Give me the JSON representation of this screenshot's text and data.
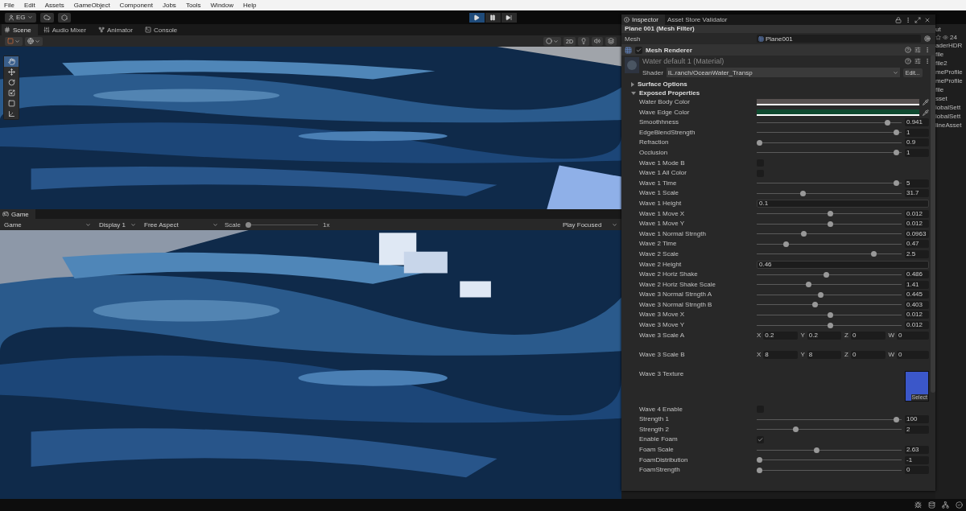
{
  "menu": [
    "File",
    "Edit",
    "Assets",
    "GameObject",
    "Component",
    "Jobs",
    "Tools",
    "Window",
    "Help"
  ],
  "toolbar": {
    "account": "EG"
  },
  "play_controls": [
    {
      "kind": "play",
      "selected": true
    },
    {
      "kind": "pause",
      "selected": false
    },
    {
      "kind": "step",
      "selected": false
    }
  ],
  "scene_tabs": [
    {
      "label": "Scene",
      "kind": "scene",
      "selected": true
    },
    {
      "label": "Audio Mixer",
      "kind": "mixer",
      "selected": false
    },
    {
      "label": "Animator",
      "kind": "animator",
      "selected": false
    },
    {
      "label": "Console",
      "kind": "console",
      "selected": false
    }
  ],
  "scene_toolbar": {
    "mode_2d": "2D"
  },
  "scene_tools": [
    {
      "kind": "hand",
      "selected": true
    },
    {
      "kind": "move",
      "selected": false
    },
    {
      "kind": "rotate",
      "selected": false
    },
    {
      "kind": "scale",
      "selected": false
    },
    {
      "kind": "rect",
      "selected": false
    },
    {
      "kind": "transform",
      "selected": false
    }
  ],
  "game_panel": {
    "tab": "Game",
    "view": "Game",
    "display": "Display 1",
    "aspect": "Free Aspect",
    "scale_label": "Scale",
    "scale": {
      "level": 0
    },
    "scale_value": "1x",
    "play_mode": "Play Focused"
  },
  "inspector": {
    "tabs": [
      {
        "label": "Inspector",
        "selected": true
      },
      {
        "label": "Asset Store Validator",
        "selected": false
      }
    ],
    "mesh_filter": {
      "title": "Plane 001 (Mesh Filter)",
      "mesh_label": "Mesh",
      "mesh_value": "Plane001"
    },
    "mesh_renderer": {
      "title": "Mesh Renderer",
      "enabled": true
    },
    "material": {
      "title": "Water default 1 (Material)",
      "shader_label": "Shader",
      "shader": "IL.ranch/OceanWater_Transp",
      "edit": "Edit..."
    },
    "sections": [
      {
        "title": "Surface Options",
        "expanded": false
      },
      {
        "title": "Exposed Properties",
        "expanded": true
      }
    ],
    "properties": [
      {
        "label": "Water Body Color",
        "kind": "color",
        "color": "#575150"
      },
      {
        "label": "Wave Edge Color",
        "kind": "color",
        "color": "#0f4a30"
      },
      {
        "label": "Smoothhness",
        "kind": "slider",
        "level": 0.92,
        "value": "0.941"
      },
      {
        "label": "EdgeBlendStrength",
        "kind": "slider",
        "level": 0.98,
        "value": "1"
      },
      {
        "label": "Refraction",
        "kind": "slider",
        "level": 0.0,
        "value": "0.9"
      },
      {
        "label": "Occlusion",
        "kind": "slider",
        "level": 0.98,
        "value": "1"
      },
      {
        "label": "Wave 1 Mode B",
        "kind": "checkbox",
        "checked": false
      },
      {
        "label": "Wave 1 All Color",
        "kind": "checkbox",
        "checked": false
      },
      {
        "label": "Wave 1 Time",
        "kind": "slider",
        "level": 0.98,
        "value": "5"
      },
      {
        "label": "Wave 1 Scale",
        "kind": "slider",
        "level": 0.31,
        "value": "31.7"
      },
      {
        "label": "Wave 1 Height",
        "kind": "field",
        "value": "0.1"
      },
      {
        "label": "Wave 1 Move X",
        "kind": "slider",
        "level": 0.51,
        "value": "0.012"
      },
      {
        "label": "Wave 1 Move Y",
        "kind": "slider",
        "level": 0.51,
        "value": "0.012"
      },
      {
        "label": "Wave 1 Normal Strngth",
        "kind": "slider",
        "level": 0.32,
        "value": "0.0963"
      },
      {
        "label": "Wave 2 Time",
        "kind": "slider",
        "level": 0.19,
        "value": "0.47"
      },
      {
        "label": "Wave 2 Scale",
        "kind": "slider",
        "level": 0.82,
        "value": "2.5"
      },
      {
        "label": "Wave 2 Height",
        "kind": "field",
        "value": "0.46"
      },
      {
        "label": "Wave 2 Horiz Shake",
        "kind": "slider",
        "level": 0.48,
        "value": "0.486"
      },
      {
        "label": "Wave 2 Horiz Shake Scale",
        "kind": "slider",
        "level": 0.35,
        "value": "1.41"
      },
      {
        "label": "Wave 3 Normal Strngth A",
        "kind": "slider",
        "level": 0.44,
        "value": "0.445"
      },
      {
        "label": "Wave 3 Normal Strngth B",
        "kind": "slider",
        "level": 0.4,
        "value": "0.403"
      },
      {
        "label": "Wave 3 Move X",
        "kind": "slider",
        "level": 0.51,
        "value": "0.012"
      },
      {
        "label": "Wave 3 Move Y",
        "kind": "slider",
        "level": 0.51,
        "value": "0.012"
      },
      {
        "label": "Wave 3 Scale A",
        "kind": "vector",
        "components": [
          {
            "axis": "X",
            "value": "0.2"
          },
          {
            "axis": "Y",
            "value": "0.2"
          },
          {
            "axis": "Z",
            "value": "0"
          },
          {
            "axis": "W",
            "value": "0"
          }
        ]
      },
      {
        "label": "Wave 3 Scale B",
        "kind": "vector",
        "components": [
          {
            "axis": "X",
            "value": "8"
          },
          {
            "axis": "Y",
            "value": "8"
          },
          {
            "axis": "Z",
            "value": "0"
          },
          {
            "axis": "W",
            "value": "0"
          }
        ]
      },
      {
        "label": "Wave 3 Texture",
        "kind": "texture",
        "button": "Select"
      },
      {
        "label": "Wave 4 Enable",
        "kind": "checkbox",
        "checked": false
      },
      {
        "label": "Strength 1",
        "kind": "slider",
        "level": 0.98,
        "value": "100"
      },
      {
        "label": "Strength 2",
        "kind": "slider",
        "level": 0.26,
        "value": "2"
      },
      {
        "label": "Enable Foam",
        "kind": "checkbox",
        "checked": true
      },
      {
        "label": "Foam Scale",
        "kind": "slider",
        "level": 0.41,
        "value": "2.63"
      },
      {
        "label": "FoamDistribution",
        "kind": "slider",
        "level": 0.0,
        "value": "-1"
      },
      {
        "label": "FoamStrength",
        "kind": "slider",
        "level": 0.0,
        "value": "0"
      }
    ]
  },
  "side_panel": {
    "dropdown": "ut",
    "count": "24",
    "items": [
      "aderHDR",
      "file",
      "file2",
      "meProfile",
      "meProfile",
      "file",
      "sset",
      "lobalSett",
      "lobalSett",
      "lineAsset"
    ]
  }
}
